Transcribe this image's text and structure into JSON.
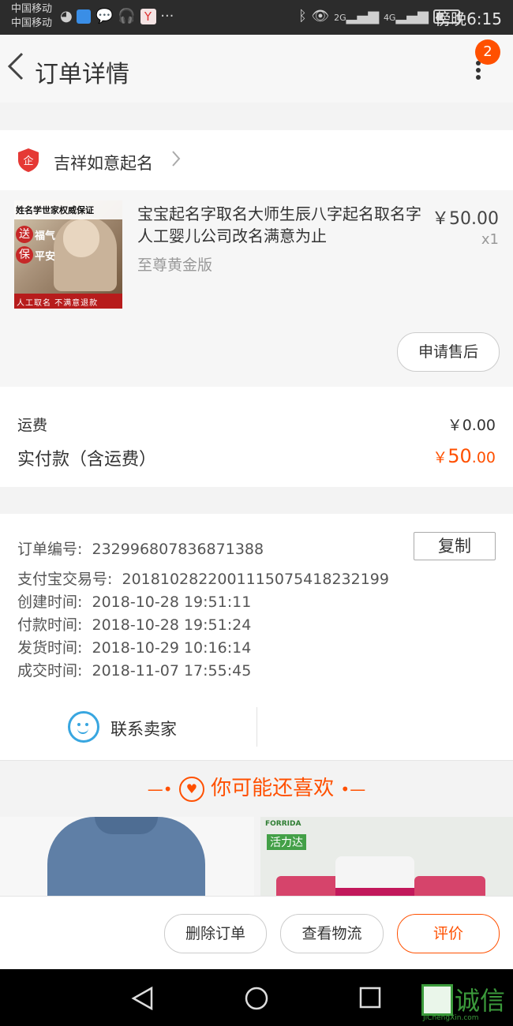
{
  "status_bar": {
    "carrier_1": "中国移动",
    "carrier_2": "中国移动",
    "network_1": "2G",
    "network_2": "4G",
    "time": "傍晚6:15"
  },
  "header": {
    "title": "订单详情",
    "notification_count": "2"
  },
  "store": {
    "name": "吉祥如意起名"
  },
  "item": {
    "title": "宝宝起名字取名大师生辰八字起名取名字人工婴儿公司改名满意为止",
    "sku": "至尊黄金版",
    "price": "￥50.00",
    "quantity": "x1",
    "after_sale_label": "申请售后",
    "thumb_banner": "姓名学世家权威保证",
    "thumb_text_1": "送",
    "thumb_text_2": "福气",
    "thumb_text_3": "保",
    "thumb_text_4": "平安",
    "thumb_footer": "人工取名 不满意退款"
  },
  "fees": {
    "shipping_label": "运费",
    "shipping_value": "￥0.00",
    "paid_label": "实付款（含运费）",
    "paid_currency": "￥",
    "paid_int": "50",
    "paid_dec": ".00"
  },
  "order_info": {
    "copy_label": "复制",
    "rows": [
      {
        "key": "订单编号:",
        "value": "232996807836871388"
      },
      {
        "key": "支付宝交易号:",
        "value": "2018102822001115075418232199"
      },
      {
        "key": "创建时间:",
        "value": "2018-10-28 19:51:11"
      },
      {
        "key": "付款时间:",
        "value": "2018-10-28 19:51:24"
      },
      {
        "key": "发货时间:",
        "value": "2018-10-29 10:16:14"
      },
      {
        "key": "成交时间:",
        "value": "2018-11-07 17:55:45"
      }
    ],
    "contact_label": "联系卖家"
  },
  "recommend": {
    "title": "你可能还喜欢",
    "product_2_brand": "FORRIDA",
    "product_2_brand_cn": "活力达"
  },
  "actions": {
    "delete_label": "删除订单",
    "logistics_label": "查看物流",
    "review_label": "评价"
  },
  "watermark": {
    "cn": "诚信",
    "en": "JiChengXin.com"
  },
  "colors": {
    "accent": "#ff5000",
    "contact_icon": "#38a6e0"
  }
}
